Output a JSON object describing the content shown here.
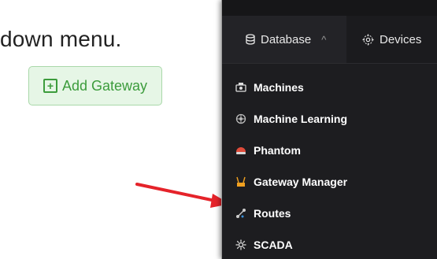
{
  "document": {
    "text_fragment": "down menu."
  },
  "add_gateway_button": {
    "label": "Add Gateway",
    "icon": "plus-square-icon",
    "colors": {
      "text": "#3c9c3c",
      "background": "#e6f6e6",
      "border": "#a9d8a9"
    }
  },
  "annotation": {
    "arrow_color": "#e5232a",
    "points_to": "Routes"
  },
  "navbar": {
    "items": [
      {
        "label": "Database",
        "icon": "database-icon",
        "expanded": true,
        "caret": "^"
      },
      {
        "label": "Devices",
        "icon": "devices-icon"
      }
    ]
  },
  "dropdown": {
    "items": [
      {
        "label": "Machines",
        "icon": "machines-icon"
      },
      {
        "label": "Machine Learning",
        "icon": "machine-learning-icon"
      },
      {
        "label": "Phantom",
        "icon": "phantom-icon"
      },
      {
        "label": "Gateway Manager",
        "icon": "gateway-manager-icon"
      },
      {
        "label": "Routes",
        "icon": "routes-icon"
      },
      {
        "label": "SCADA",
        "icon": "scada-icon"
      }
    ]
  },
  "theme": {
    "panel_background": "#1f1f22",
    "menu_text": "#ffffff",
    "phantom_icon_color": "#e04b3a",
    "gateway_icon_color": "#f0a020"
  }
}
